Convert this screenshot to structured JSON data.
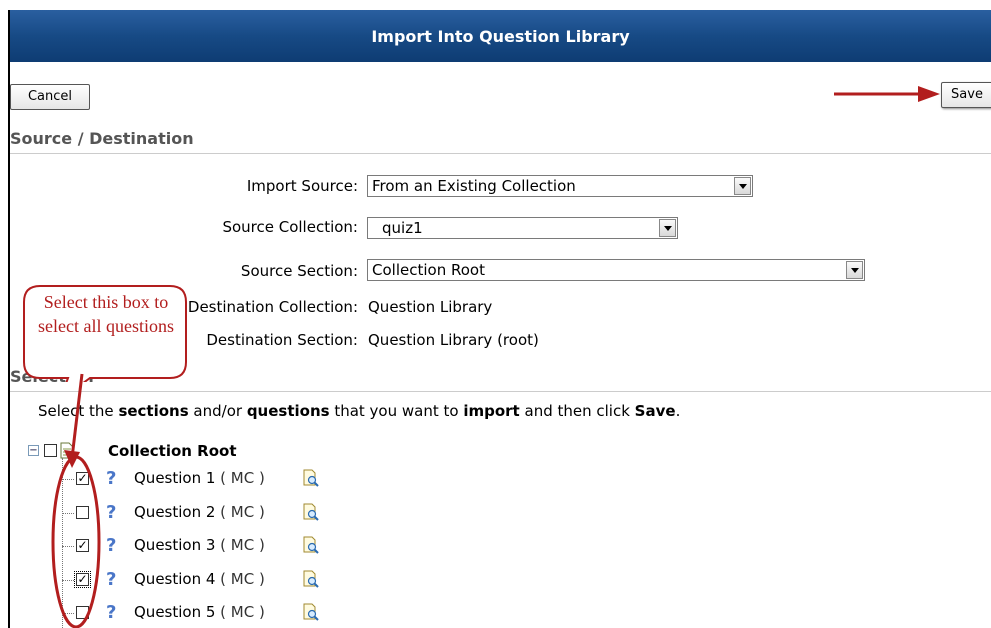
{
  "window": {
    "title": "Import Into Question Library"
  },
  "toolbar": {
    "cancel_label": "Cancel",
    "save_label": "Save"
  },
  "source_destination": {
    "heading": "Source / Destination",
    "import_source": {
      "label": "Import Source:",
      "value": "From an Existing Collection"
    },
    "source_collection": {
      "label": "Source Collection:",
      "value": "quiz1"
    },
    "source_section": {
      "label": "Source Section:",
      "value": "Collection Root"
    },
    "destination_collection": {
      "label": "Destination Collection:",
      "value": "Question Library"
    },
    "destination_section": {
      "label": "Destination Section:",
      "value": "Question Library (root)"
    }
  },
  "selection": {
    "heading": "Selection",
    "instruction_parts": [
      "Select the ",
      "sections",
      " and/or ",
      "questions",
      " that you want to ",
      "import",
      " and then click ",
      "Save",
      "."
    ],
    "root": {
      "label": "Collection Root",
      "checked": false
    },
    "questions": [
      {
        "label": "Question 1",
        "type": "( MC )",
        "checked": true
      },
      {
        "label": "Question 2",
        "type": "( MC )",
        "checked": false
      },
      {
        "label": "Question 3",
        "type": "( MC )",
        "checked": true
      },
      {
        "label": "Question 4",
        "type": "( MC )",
        "checked": true
      },
      {
        "label": "Question 5",
        "type": "( MC )",
        "checked": false
      }
    ]
  },
  "annotation": {
    "callout_text": "Select this box to select all questions"
  },
  "colors": {
    "title_bar": "#174a85",
    "annotation_red": "#b21e1e"
  }
}
